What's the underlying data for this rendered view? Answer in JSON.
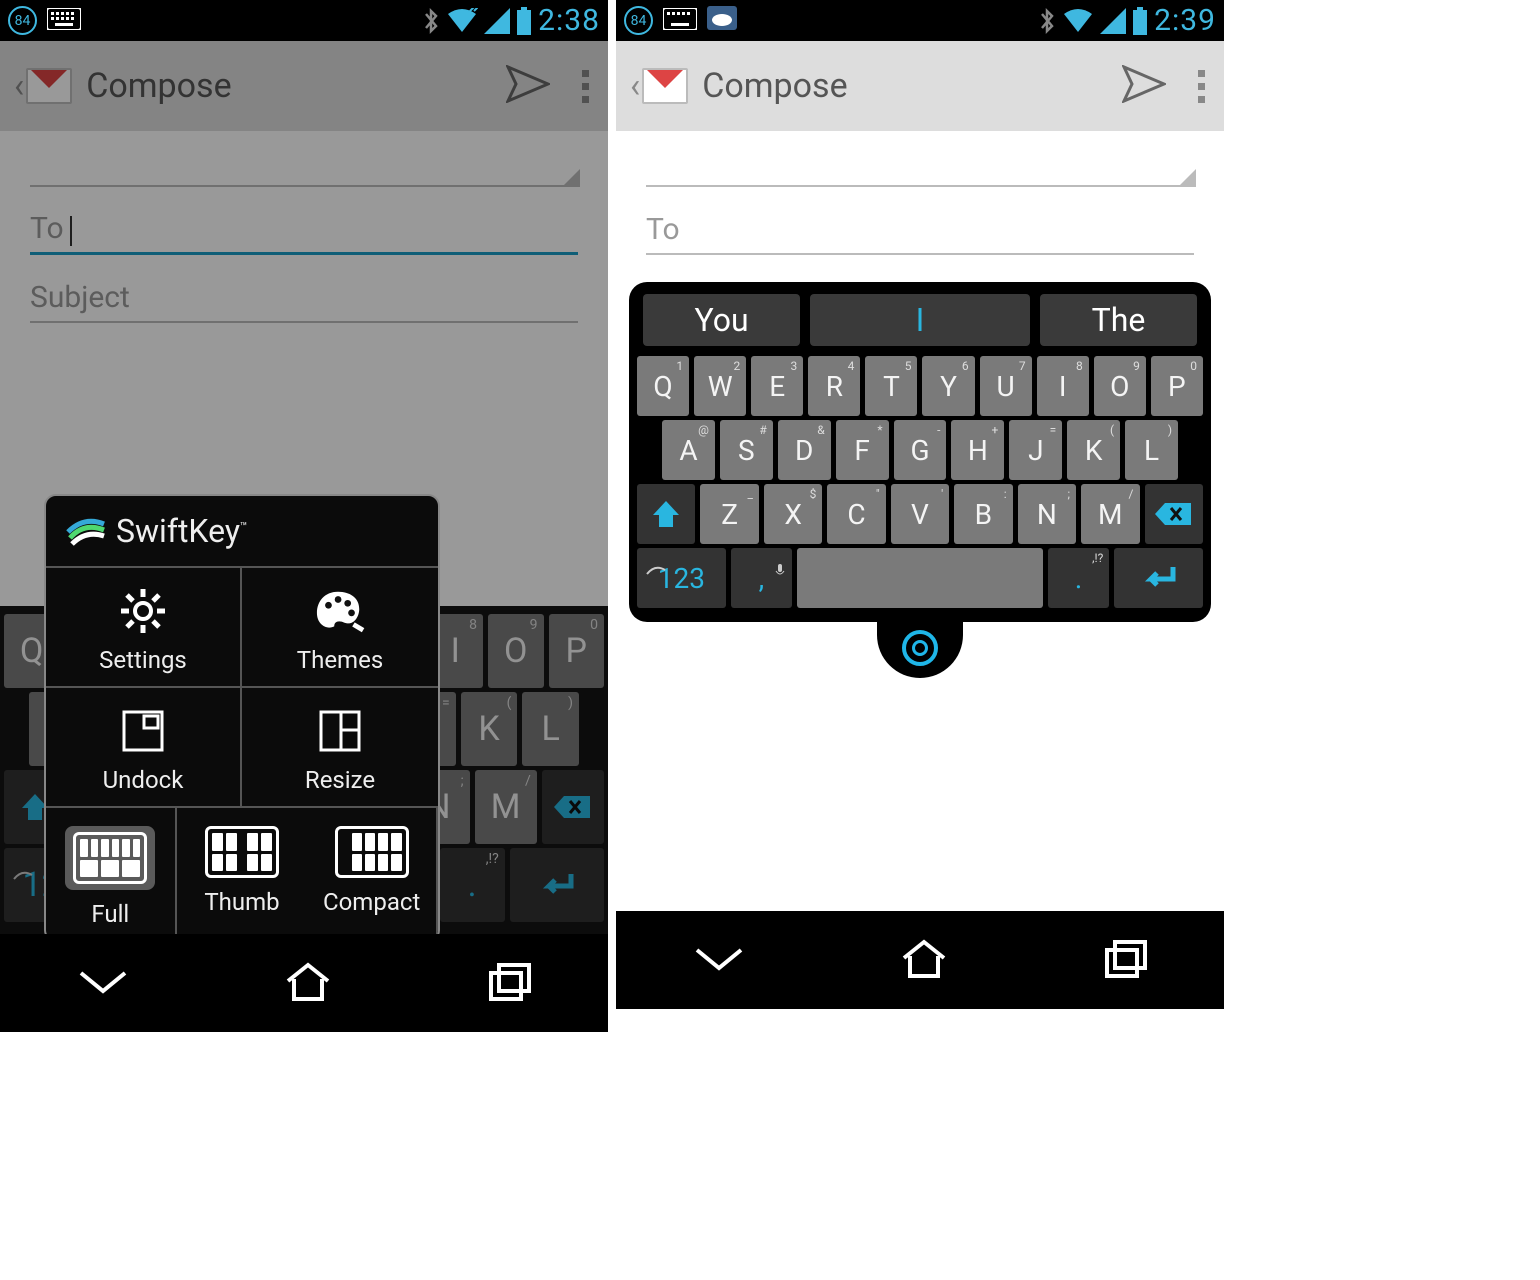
{
  "status": {
    "battery": "84",
    "timeLeft": "2:38",
    "timeRight": "2:39"
  },
  "action": {
    "title": "Compose"
  },
  "fields": {
    "to": "To",
    "subject": "Subject"
  },
  "popup": {
    "title": "SwiftKey",
    "tm": "™",
    "settings": "Settings",
    "themes": "Themes",
    "undock": "Undock",
    "resize": "Resize",
    "full": "Full",
    "thumb": "Thumb",
    "compact": "Compact"
  },
  "suggestions": {
    "left": "You",
    "mid": "I",
    "right": "The"
  },
  "keys": {
    "row1": [
      {
        "k": "Q",
        "s": "1"
      },
      {
        "k": "W",
        "s": "2"
      },
      {
        "k": "E",
        "s": "3"
      },
      {
        "k": "R",
        "s": "4"
      },
      {
        "k": "T",
        "s": "5"
      },
      {
        "k": "Y",
        "s": "6"
      },
      {
        "k": "U",
        "s": "7"
      },
      {
        "k": "I",
        "s": "8"
      },
      {
        "k": "O",
        "s": "9"
      },
      {
        "k": "P",
        "s": "0"
      }
    ],
    "row2": [
      {
        "k": "A",
        "s": "@"
      },
      {
        "k": "S",
        "s": "#"
      },
      {
        "k": "D",
        "s": "&"
      },
      {
        "k": "F",
        "s": "*"
      },
      {
        "k": "G",
        "s": "-"
      },
      {
        "k": "H",
        "s": "+"
      },
      {
        "k": "J",
        "s": "="
      },
      {
        "k": "K",
        "s": "("
      },
      {
        "k": "L",
        "s": ")"
      }
    ],
    "row3": [
      {
        "k": "Z",
        "s": "_"
      },
      {
        "k": "X",
        "s": "$"
      },
      {
        "k": "C",
        "s": "\""
      },
      {
        "k": "V",
        "s": "'"
      },
      {
        "k": "B",
        "s": ":"
      },
      {
        "k": "N",
        "s": ";"
      },
      {
        "k": "M",
        "s": "/"
      }
    ],
    "numKey": "123",
    "commaKey": ",",
    "dotKey": ".",
    "puncHint": ",!?",
    "emojiHint": "☺"
  }
}
